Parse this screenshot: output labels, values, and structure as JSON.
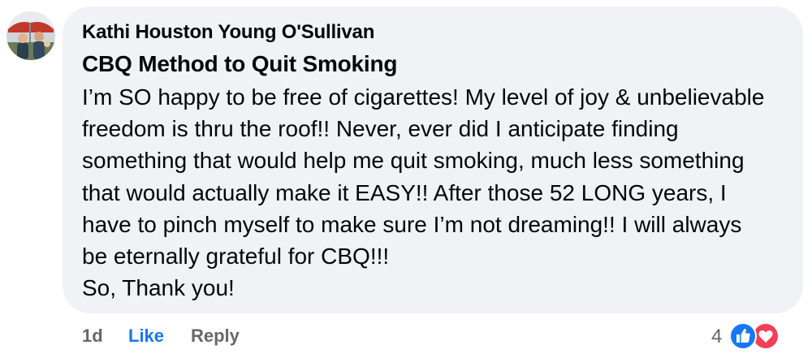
{
  "comment": {
    "author": "Kathi Houston Young O'Sullivan",
    "group_title": "CBQ Method to Quit Smoking",
    "body_lines": [
      "I’m SO happy to be free of cigarettes! My level of joy & unbelievable",
      "freedom is thru the roof!! Never, ever did I anticipate finding",
      "something that would help me quit smoking, much less something",
      "that would actually make it EASY!! After those 52 LONG years, I",
      "have to pinch myself to make sure I’m not dreaming!! I will always",
      "be eternally grateful for CBQ!!!",
      "So, Thank you!"
    ]
  },
  "actions": {
    "time": "1d",
    "like_label": "Like",
    "reply_label": "Reply"
  },
  "reactions": {
    "count": "4",
    "icons": [
      "like-reaction-icon",
      "love-reaction-icon"
    ]
  },
  "colors": {
    "bubble_bg": "#f0f2f5",
    "text": "#050505",
    "secondary_text": "#65676b",
    "like_blue": "#1877f2",
    "love_red": "#f33e58"
  }
}
